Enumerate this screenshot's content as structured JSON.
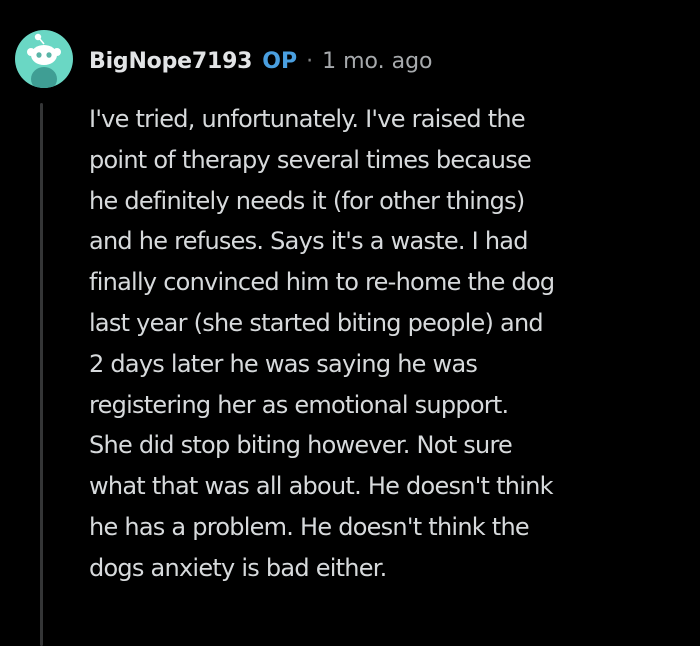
{
  "comment": {
    "author": "BigNope7193",
    "op_badge": "OP",
    "separator": "·",
    "timestamp": "1 mo. ago",
    "avatar_icon": "reddit-snoo-avatar-icon",
    "body_lines": [
      "I've tried, unfortunately. I've raised the",
      "point of therapy several times because",
      "he definitely needs it (for other things)",
      "and he refuses. Says it's a waste. I had",
      "finally convinced him to re-home the dog",
      "last year (she started biting people) and",
      "2 days later he was saying he was",
      "registering her as emotional support.",
      "She did stop biting however. Not sure",
      "what that was all about. He doesn't think",
      "he has a problem. He doesn't think the",
      "dogs anxiety is bad either."
    ]
  },
  "colors": {
    "background": "#000000",
    "avatar_bg": "#6ad7c4",
    "op_badge": "#4a9fe0",
    "text": "#d7dadc",
    "thread_line": "#343536"
  }
}
